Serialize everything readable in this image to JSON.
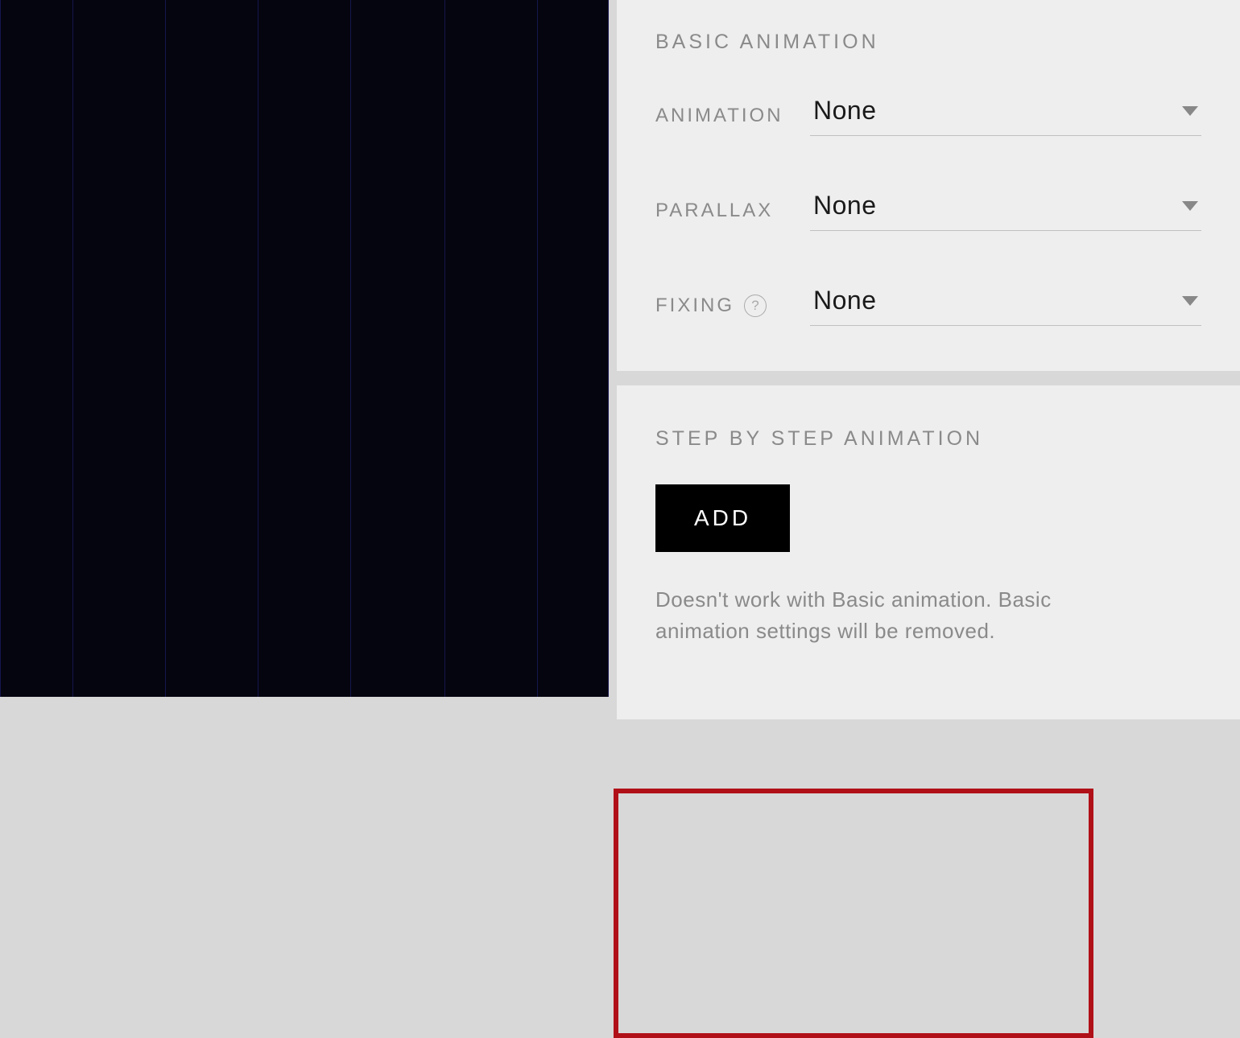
{
  "basic_animation": {
    "title": "BASIC ANIMATION",
    "fields": {
      "animation": {
        "label": "ANIMATION",
        "value": "None"
      },
      "parallax": {
        "label": "PARALLAX",
        "value": "None"
      },
      "fixing": {
        "label": "FIXING",
        "value": "None",
        "has_help": true
      }
    }
  },
  "step_animation": {
    "title": "STEP BY STEP ANIMATION",
    "add_label": "ADD",
    "note": "Doesn't work with Basic animation. Basic animation settings will be removed."
  },
  "grid_positions": [
    0,
    90,
    205,
    320,
    435,
    552,
    667,
    755
  ]
}
